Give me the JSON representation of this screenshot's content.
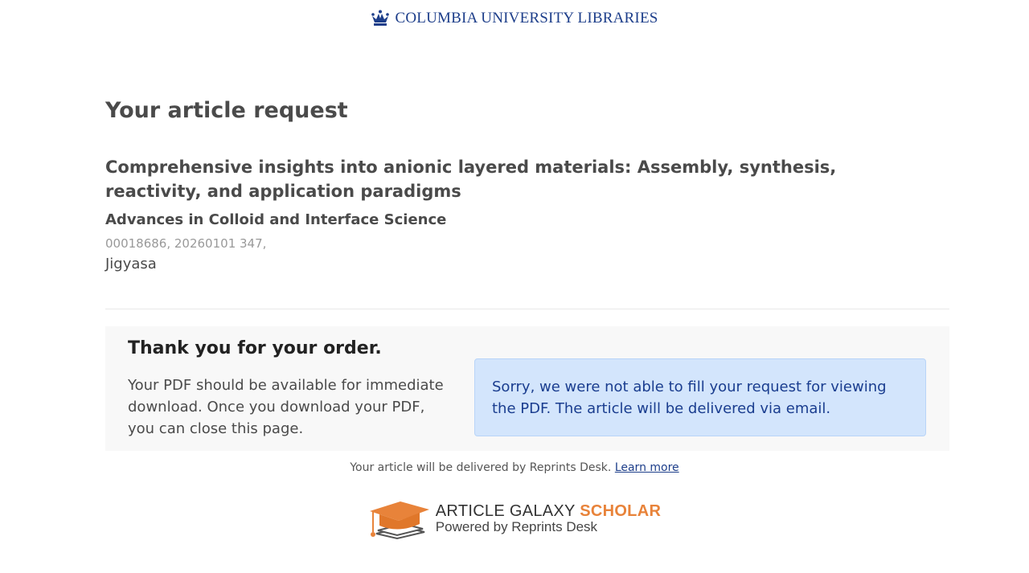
{
  "header": {
    "library_name": "COLUMBIA UNIVERSITY LIBRARIES"
  },
  "page": {
    "title": "Your article request"
  },
  "article": {
    "title": "Comprehensive insights into anionic layered materials: Assembly, synthesis, reactivity, and application paradigms",
    "journal": "Advances in Colloid and Interface Science",
    "meta": "00018686, 20260101 347,",
    "author": "Jigyasa"
  },
  "order": {
    "heading": "Thank you for your order.",
    "body": "Your PDF should be available for immediate download. Once you download your PDF, you can close this page.",
    "alert": "Sorry, we were not able to fill your request for viewing the PDF. The article will be delivered via email."
  },
  "footer": {
    "delivery_text": "Your article will be delivered by Reprints Desk.",
    "learn_more": "Learn more",
    "brand_article_galaxy": "ARTICLE GALAXY",
    "brand_scholar": "SCHOLAR",
    "brand_powered_by": "Powered by Reprints Desk"
  },
  "colors": {
    "brand_blue": "#1d3e8a",
    "alert_bg": "#d3e5fc",
    "alert_text": "#1a3d8f",
    "scholar_orange": "#e8833a"
  },
  "icons": {
    "header_logo": "crown-icon",
    "footer_logo": "graduation-cap-book-icon"
  }
}
